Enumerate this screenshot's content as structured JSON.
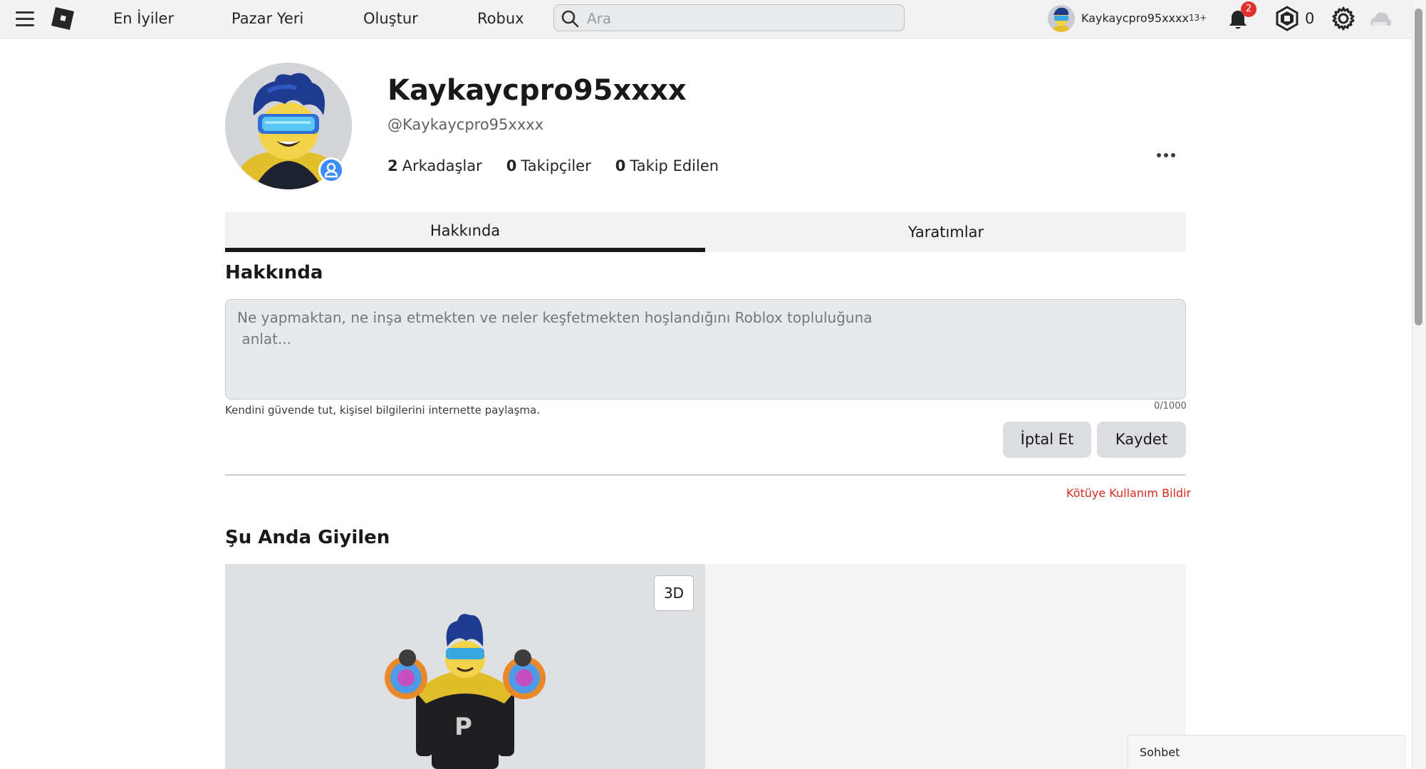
{
  "nav": {
    "links": [
      "En İyiler",
      "Pazar Yeri",
      "Oluştur",
      "Robux"
    ],
    "search_placeholder": "Ara",
    "username": "Kaykaycpro95xxxx",
    "age_badge": "13+",
    "notification_count": "2",
    "robux_balance": "0"
  },
  "profile": {
    "display_name": "Kaykaycpro95xxxx",
    "handle": "@Kaykaycpro95xxxx",
    "stats": [
      {
        "count": "2",
        "label": "Arkadaşlar"
      },
      {
        "count": "0",
        "label": "Takipçiler"
      },
      {
        "count": "0",
        "label": "Takip Edilen"
      }
    ]
  },
  "tabs": [
    {
      "label": "Hakkında",
      "active": true
    },
    {
      "label": "Yaratımlar",
      "active": false
    }
  ],
  "about": {
    "title": "Hakkında",
    "placeholder": "Ne yapmaktan, ne inşa etmekten ve neler keşfetmekten hoşlandığını Roblox topluluğuna\n anlat...",
    "counter": "0/1000",
    "safety_note": "Kendini güvende tut, kişisel bilgilerini internette paylaşma.",
    "cancel_label": "İptal Et",
    "save_label": "Kaydet",
    "report_label": "Kötüye Kullanım Bildir"
  },
  "wearing": {
    "title": "Şu Anda Giyilen",
    "toggle_3d": "3D"
  },
  "chat": {
    "label": "Sohbet"
  },
  "colors": {
    "accent_blue": "#3a8ef6",
    "badge_red": "#e0312a",
    "report_red": "#d92b1f"
  }
}
